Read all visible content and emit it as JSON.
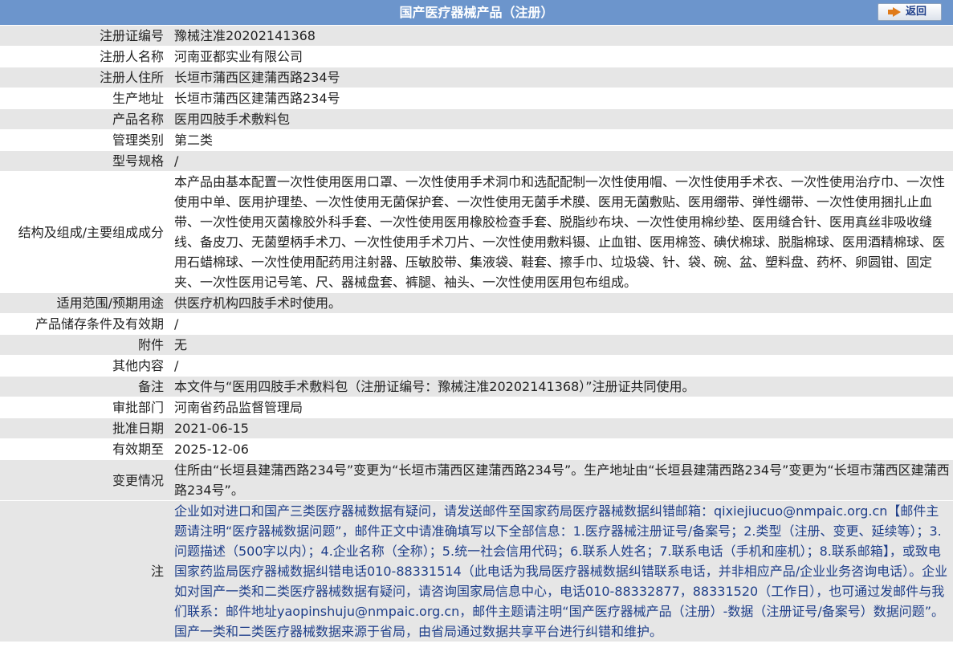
{
  "header": {
    "title": "国产医疗器械产品（注册）",
    "back_label": "返回"
  },
  "rows": [
    {
      "label": "注册证编号",
      "value": "豫械注准20202141368"
    },
    {
      "label": "注册人名称",
      "value": "河南亚都实业有限公司"
    },
    {
      "label": "注册人住所",
      "value": "长垣市蒲西区建蒲西路234号"
    },
    {
      "label": "生产地址",
      "value": "长垣市蒲西区建蒲西路234号"
    },
    {
      "label": "产品名称",
      "value": "医用四肢手术敷料包"
    },
    {
      "label": "管理类别",
      "value": "第二类"
    },
    {
      "label": "型号规格",
      "value": "/"
    },
    {
      "label": "结构及组成/主要组成成分",
      "value": "本产品由基本配置一次性使用医用口罩、一次性使用手术洞巾和选配配制一次性使用帽、一次性使用手术衣、一次性使用治疗巾、一次性使用中单、医用护理垫、一次性使用无菌保护套、一次性使用无菌手术膜、医用无菌敷贴、医用绷带、弹性绷带、一次性使用捆扎止血带、一次性使用灭菌橡胶外科手套、一次性使用医用橡胶检查手套、脱脂纱布块、一次性使用棉纱垫、医用缝合针、医用真丝非吸收缝线、备皮刀、无菌塑柄手术刀、一次性使用手术刀片、一次性使用敷料镊、止血钳、医用棉签、碘伏棉球、脱脂棉球、医用酒精棉球、医用石蜡棉球、一次性使用配药用注射器、压敏胶带、集液袋、鞋套、擦手巾、垃圾袋、针、袋、碗、盆、塑料盘、药杯、卵圆钳、固定夹、一次性医用记号笔、尺、器械盘套、裤腿、袖头、一次性使用医用包布组成。"
    },
    {
      "label": "适用范围/预期用途",
      "value": "供医疗机构四肢手术时使用。"
    },
    {
      "label": "产品储存条件及有效期",
      "value": "/"
    },
    {
      "label": "附件",
      "value": "无"
    },
    {
      "label": "其他内容",
      "value": "/"
    },
    {
      "label": "备注",
      "value": "本文件与“医用四肢手术敷料包（注册证编号：豫械注准20202141368）”注册证共同使用。"
    },
    {
      "label": "审批部门",
      "value": "河南省药品监督管理局"
    },
    {
      "label": "批准日期",
      "value": "2021-06-15"
    },
    {
      "label": "有效期至",
      "value": "2025-12-06"
    },
    {
      "label": "变更情况",
      "value": "住所由“长垣县建蒲西路234号”变更为“长垣市蒲西区建蒲西路234号”。生产地址由“长垣县建蒲西路234号”变更为“长垣市蒲西区建蒲西路234号”。"
    }
  ],
  "note": {
    "label": "注",
    "value": "企业如对进口和国产三类医疗器械数据有疑问，请发送邮件至国家药局医疗器械数据纠错邮箱：qixiejiucuo@nmpaic.org.cn【邮件主题请注明“医疗器械数据问题”，邮件正文中请准确填写以下全部信息：1.医疗器械注册证号/备案号；2.类型（注册、变更、延续等）；3.问题描述（500字以内）；4.企业名称（全称）；5.统一社会信用代码；6.联系人姓名；7.联系电话（手机和座机）；8.联系邮箱】，或致电国家药监局医疗器械数据纠错电话010-88331514（此电话为我局医疗器械数据纠错联系电话，并非相应产品/企业业务咨询电话）。企业如对国产一类和二类医疗器械数据有疑问，请咨询国家局信息中心，电话010-88332877，88331520（工作日），也可通过发邮件与我们联系：邮件地址yaopinshuju@nmpaic.org.cn，邮件主题请注明“国产医疗器械产品（注册）-数据（注册证号/备案号）数据问题”。国产一类和二类医疗器械数据来源于省局，由省局通过数据共享平台进行纠错和维护。"
  },
  "colors": {
    "header_bg": "#6c95cc",
    "row_shaded": "#e6e6e6",
    "note_text": "#1f3f8a",
    "back_arrow": "#e07b1a"
  }
}
